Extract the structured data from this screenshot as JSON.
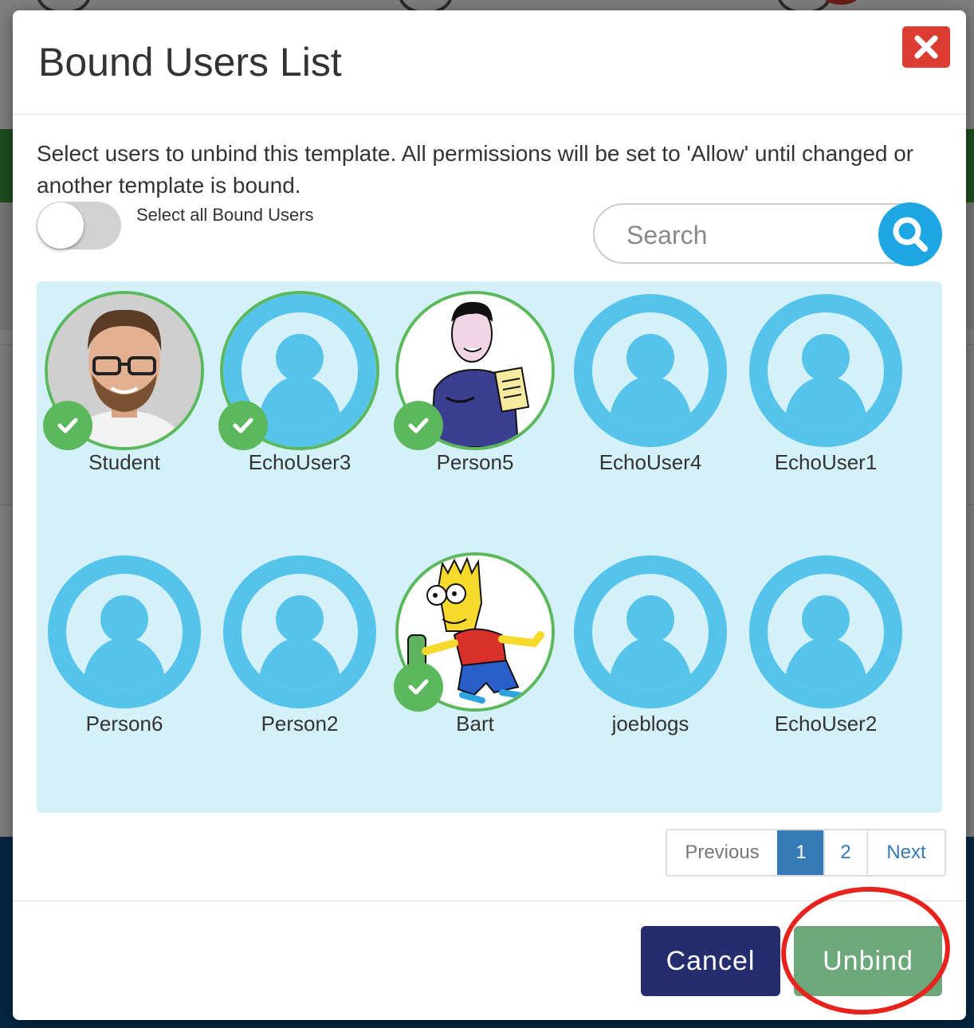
{
  "modal": {
    "title": "Bound Users List",
    "description": "Select users to unbind this template. All permissions will be set to 'Allow' until changed or another template is bound."
  },
  "select_all": {
    "label": "Select all Bound Users",
    "checked": false
  },
  "search": {
    "placeholder": "Search",
    "value": ""
  },
  "users": [
    {
      "name": "Student",
      "avatar": "photo",
      "selected": true
    },
    {
      "name": "EchoUser3",
      "avatar": "default",
      "selected": true
    },
    {
      "name": "Person5",
      "avatar": "drawing",
      "selected": true
    },
    {
      "name": "EchoUser4",
      "avatar": "default",
      "selected": false
    },
    {
      "name": "EchoUser1",
      "avatar": "default",
      "selected": false
    },
    {
      "name": "Person6",
      "avatar": "default",
      "selected": false
    },
    {
      "name": "Person2",
      "avatar": "default",
      "selected": false
    },
    {
      "name": "Bart",
      "avatar": "cartoon",
      "selected": true
    },
    {
      "name": "joeblogs",
      "avatar": "default",
      "selected": false
    },
    {
      "name": "EchoUser2",
      "avatar": "default",
      "selected": false
    }
  ],
  "pagination": {
    "previous": "Previous",
    "pages": [
      "1",
      "2"
    ],
    "current": "1",
    "next": "Next"
  },
  "footer": {
    "cancel_label": "Cancel",
    "unbind_label": "Unbind"
  },
  "colors": {
    "close": "#dc3d33",
    "selected_check": "#5cb85c",
    "avatar_blue": "#56c4ea",
    "panel": "#d4f1f9",
    "cancel": "#262d6e",
    "unbind": "#6ca87a",
    "highlight": "#e8231e",
    "page_active": "#337ab7"
  }
}
